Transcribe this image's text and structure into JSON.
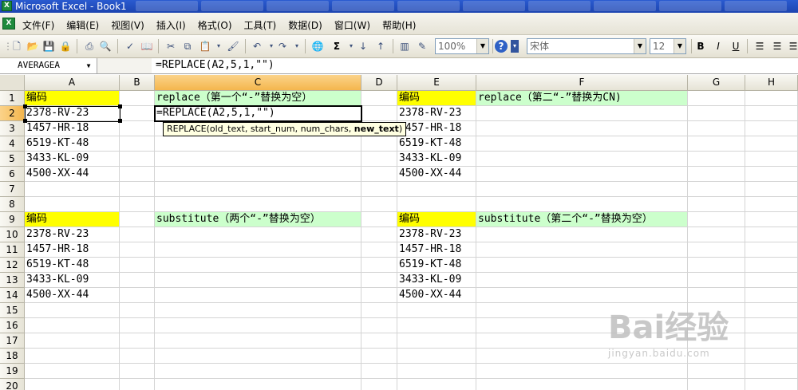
{
  "window": {
    "title": "Microsoft Excel - Book1"
  },
  "menu": [
    "文件(F)",
    "编辑(E)",
    "视图(V)",
    "插入(I)",
    "格式(O)",
    "工具(T)",
    "数据(D)",
    "窗口(W)",
    "帮助(H)"
  ],
  "toolbar": {
    "zoom": "100%",
    "font": "宋体",
    "font_size": "12",
    "bold": "B",
    "italic": "I",
    "underline": "U",
    "sum": "Σ"
  },
  "formula_bar": {
    "name_box": "AVERAGEA",
    "formula": "=REPLACE(A2,5,1,\"\")"
  },
  "columns": [
    "A",
    "B",
    "C",
    "D",
    "E",
    "F",
    "G",
    "H"
  ],
  "rows": [
    "1",
    "2",
    "3",
    "4",
    "5",
    "6",
    "7",
    "8",
    "9",
    "10",
    "11",
    "12",
    "13",
    "14",
    "15",
    "16",
    "17",
    "18",
    "19",
    "20"
  ],
  "cells": {
    "A1": "编码",
    "C1": "replace（第一个“-”替换为空）",
    "E1": "编码",
    "F1": "replace（第二“-”替换为CN)",
    "A2": "2378-RV-23",
    "C2": "=REPLACE(A2,5,1,\"\")",
    "E2": "2378-RV-23",
    "A3": "1457-HR-18",
    "E3": "1457-HR-18",
    "A4": "6519-KT-48",
    "E4": "6519-KT-48",
    "A5": "3433-KL-09",
    "E5": "3433-KL-09",
    "A6": "4500-XX-44",
    "E6": "4500-XX-44",
    "A9": "编码",
    "C9": "substitute（两个“-”替换为空）",
    "E9": "编码",
    "F9": "substitute（第二个“-”替换为空）",
    "A10": "2378-RV-23",
    "E10": "2378-RV-23",
    "A11": "1457-HR-18",
    "E11": "1457-HR-18",
    "A12": "6519-KT-48",
    "E12": "6519-KT-48",
    "A13": "3433-KL-09",
    "E13": "3433-KL-09",
    "A14": "4500-XX-44",
    "E14": "4500-XX-44"
  },
  "tooltip": {
    "prefix": "REPLACE(old_text, start_num, num_chars, ",
    "bold_arg": "new_text",
    "suffix": ")"
  },
  "watermark": {
    "brand": "Bai经验",
    "url": "jingyan.baidu.com"
  },
  "colors": {
    "header_yellow": "#ffff00",
    "header_green": "#ccffcc",
    "selected_header": "#f4b64d"
  }
}
